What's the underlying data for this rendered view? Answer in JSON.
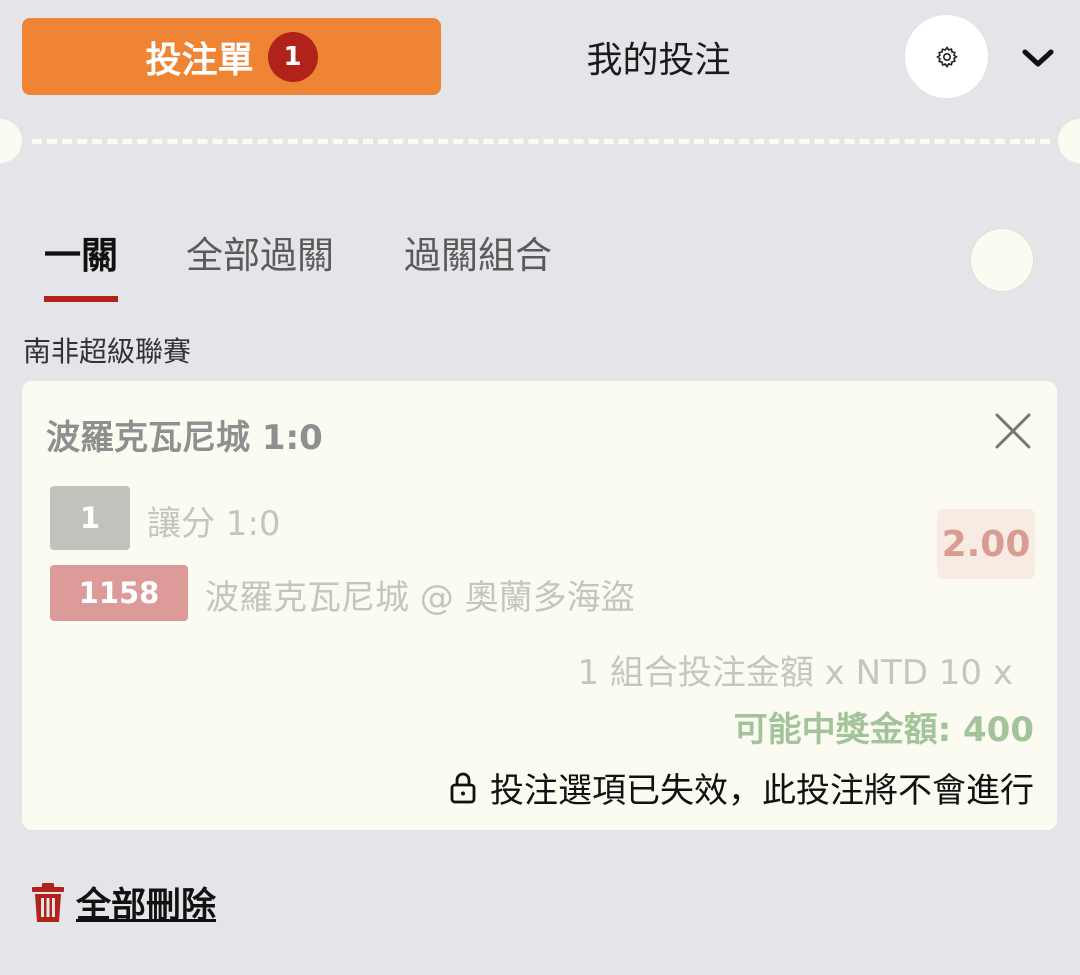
{
  "header": {
    "betslip_label": "投注單",
    "betslip_count": "1",
    "mybets_label": "我的投注"
  },
  "tabs": [
    {
      "label": "一關",
      "active": true
    },
    {
      "label": "全部過關",
      "active": false
    },
    {
      "label": "過關組合",
      "active": false
    }
  ],
  "league": "南非超級聯賽",
  "bet": {
    "match": "波羅克瓦尼城 1:0",
    "selection_number": "1",
    "selection_text": "讓分 1:0",
    "event_code": "1158",
    "event_text": "波羅克瓦尼城 @ 奧蘭多海盜",
    "odds": "2.00",
    "stake_text": "1 組合投注金額 x NTD 10 x",
    "winnings_text": "可能中獎金額: 400",
    "expired_text": "投注選項已失效，此投注將不會進行"
  },
  "footer": {
    "delete_all_label": "全部刪除"
  },
  "colors": {
    "accent_orange": "#ee8434",
    "badge_red": "#b1221b",
    "background": "#e4e5e9",
    "card": "#fbfbf1",
    "winnings_green": "#a3c49a"
  },
  "icons": [
    "gear-icon",
    "chevron-down-icon",
    "close-icon",
    "lock-icon",
    "trash-icon"
  ]
}
